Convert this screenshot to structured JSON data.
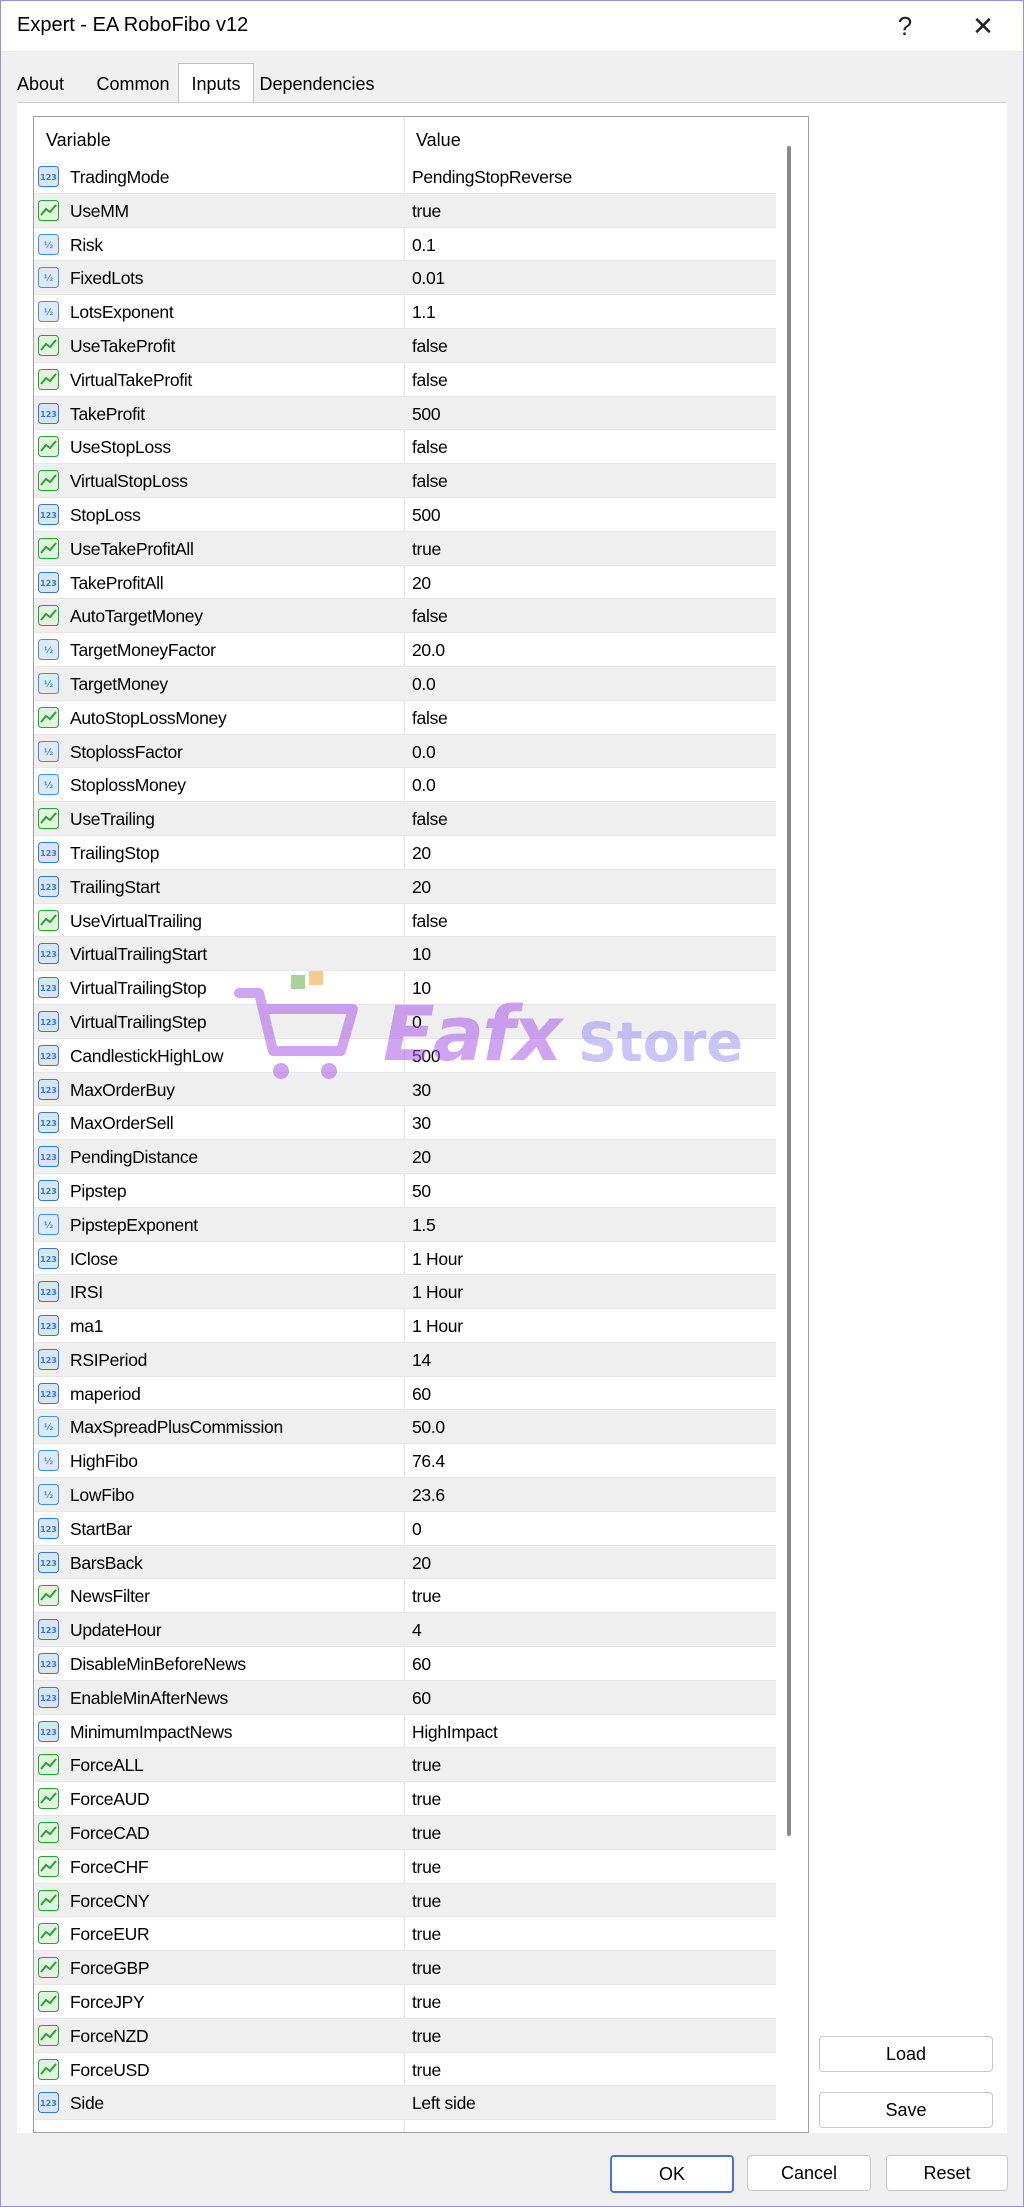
{
  "window": {
    "title": "Expert - EA RoboFibo v12",
    "help_glyph": "?",
    "close_glyph": "✕"
  },
  "tabs": [
    {
      "label": "About",
      "active": false
    },
    {
      "label": "Common",
      "active": false
    },
    {
      "label": "Inputs",
      "active": true
    },
    {
      "label": "Dependencies",
      "active": false
    }
  ],
  "grid": {
    "col_variable": "Variable",
    "col_value": "Value",
    "rows": [
      {
        "type": "int",
        "name": "TradingMode",
        "value": "PendingStopReverse"
      },
      {
        "type": "bool",
        "name": "UseMM",
        "value": "true"
      },
      {
        "type": "double",
        "name": "Risk",
        "value": "0.1"
      },
      {
        "type": "double",
        "name": "FixedLots",
        "value": "0.01"
      },
      {
        "type": "double",
        "name": "LotsExponent",
        "value": "1.1"
      },
      {
        "type": "bool",
        "name": "UseTakeProfit",
        "value": "false"
      },
      {
        "type": "bool",
        "name": "VirtualTakeProfit",
        "value": "false"
      },
      {
        "type": "int",
        "name": "TakeProfit",
        "value": "500"
      },
      {
        "type": "bool",
        "name": "UseStopLoss",
        "value": "false"
      },
      {
        "type": "bool",
        "name": "VirtualStopLoss",
        "value": "false"
      },
      {
        "type": "int",
        "name": "StopLoss",
        "value": "500"
      },
      {
        "type": "bool",
        "name": "UseTakeProfitAll",
        "value": "true"
      },
      {
        "type": "int",
        "name": "TakeProfitAll",
        "value": "20"
      },
      {
        "type": "bool",
        "name": "AutoTargetMoney",
        "value": "false"
      },
      {
        "type": "double",
        "name": "TargetMoneyFactor",
        "value": "20.0"
      },
      {
        "type": "double",
        "name": "TargetMoney",
        "value": "0.0"
      },
      {
        "type": "bool",
        "name": "AutoStopLossMoney",
        "value": "false"
      },
      {
        "type": "double",
        "name": "StoplossFactor",
        "value": "0.0"
      },
      {
        "type": "double",
        "name": "StoplossMoney",
        "value": "0.0"
      },
      {
        "type": "bool",
        "name": "UseTrailing",
        "value": "false"
      },
      {
        "type": "int",
        "name": "TrailingStop",
        "value": "20"
      },
      {
        "type": "int",
        "name": "TrailingStart",
        "value": "20"
      },
      {
        "type": "bool",
        "name": "UseVirtualTrailing",
        "value": "false"
      },
      {
        "type": "int",
        "name": "VirtualTrailingStart",
        "value": "10"
      },
      {
        "type": "int",
        "name": "VirtualTrailingStop",
        "value": "10"
      },
      {
        "type": "int",
        "name": "VirtualTrailingStep",
        "value": "0"
      },
      {
        "type": "int",
        "name": "CandlestickHighLow",
        "value": "500"
      },
      {
        "type": "int",
        "name": "MaxOrderBuy",
        "value": "30"
      },
      {
        "type": "int",
        "name": "MaxOrderSell",
        "value": "30"
      },
      {
        "type": "int",
        "name": "PendingDistance",
        "value": "20"
      },
      {
        "type": "int",
        "name": "Pipstep",
        "value": "50"
      },
      {
        "type": "double",
        "name": "PipstepExponent",
        "value": "1.5"
      },
      {
        "type": "int",
        "name": "IClose",
        "value": "1 Hour"
      },
      {
        "type": "int",
        "name": "IRSI",
        "value": "1 Hour"
      },
      {
        "type": "int",
        "name": "ma1",
        "value": "1 Hour"
      },
      {
        "type": "int",
        "name": "RSIPeriod",
        "value": "14"
      },
      {
        "type": "int",
        "name": "maperiod",
        "value": "60"
      },
      {
        "type": "double",
        "name": "MaxSpreadPlusCommission",
        "value": "50.0"
      },
      {
        "type": "double",
        "name": "HighFibo",
        "value": "76.4"
      },
      {
        "type": "double",
        "name": "LowFibo",
        "value": "23.6"
      },
      {
        "type": "int",
        "name": "StartBar",
        "value": "0"
      },
      {
        "type": "int",
        "name": "BarsBack",
        "value": "20"
      },
      {
        "type": "bool",
        "name": "NewsFilter",
        "value": "true"
      },
      {
        "type": "int",
        "name": "UpdateHour",
        "value": "4"
      },
      {
        "type": "int",
        "name": "DisableMinBeforeNews",
        "value": "60"
      },
      {
        "type": "int",
        "name": "EnableMinAfterNews",
        "value": "60"
      },
      {
        "type": "int",
        "name": "MinimumImpactNews",
        "value": "HighImpact"
      },
      {
        "type": "bool",
        "name": "ForceALL",
        "value": "true"
      },
      {
        "type": "bool",
        "name": "ForceAUD",
        "value": "true"
      },
      {
        "type": "bool",
        "name": "ForceCAD",
        "value": "true"
      },
      {
        "type": "bool",
        "name": "ForceCHF",
        "value": "true"
      },
      {
        "type": "bool",
        "name": "ForceCNY",
        "value": "true"
      },
      {
        "type": "bool",
        "name": "ForceEUR",
        "value": "true"
      },
      {
        "type": "bool",
        "name": "ForceGBP",
        "value": "true"
      },
      {
        "type": "bool",
        "name": "ForceJPY",
        "value": "true"
      },
      {
        "type": "bool",
        "name": "ForceNZD",
        "value": "true"
      },
      {
        "type": "bool",
        "name": "ForceUSD",
        "value": "true"
      },
      {
        "type": "int",
        "name": "Side",
        "value": "Left side"
      }
    ]
  },
  "icons": {
    "int": "int-type-icon",
    "bool": "bool-type-icon",
    "double": "double-type-icon"
  },
  "side_buttons": {
    "load": "Load",
    "save": "Save"
  },
  "bottom_buttons": {
    "ok": "OK",
    "cancel": "Cancel",
    "reset": "Reset"
  },
  "watermark": {
    "text_main": "Eafx",
    "text_store": "Store"
  },
  "colors": {
    "accent": "#4a6fd6",
    "int_icon": "#3a78c8",
    "bool_icon": "#2e9e3a",
    "double_icon": "#4a90d9"
  }
}
